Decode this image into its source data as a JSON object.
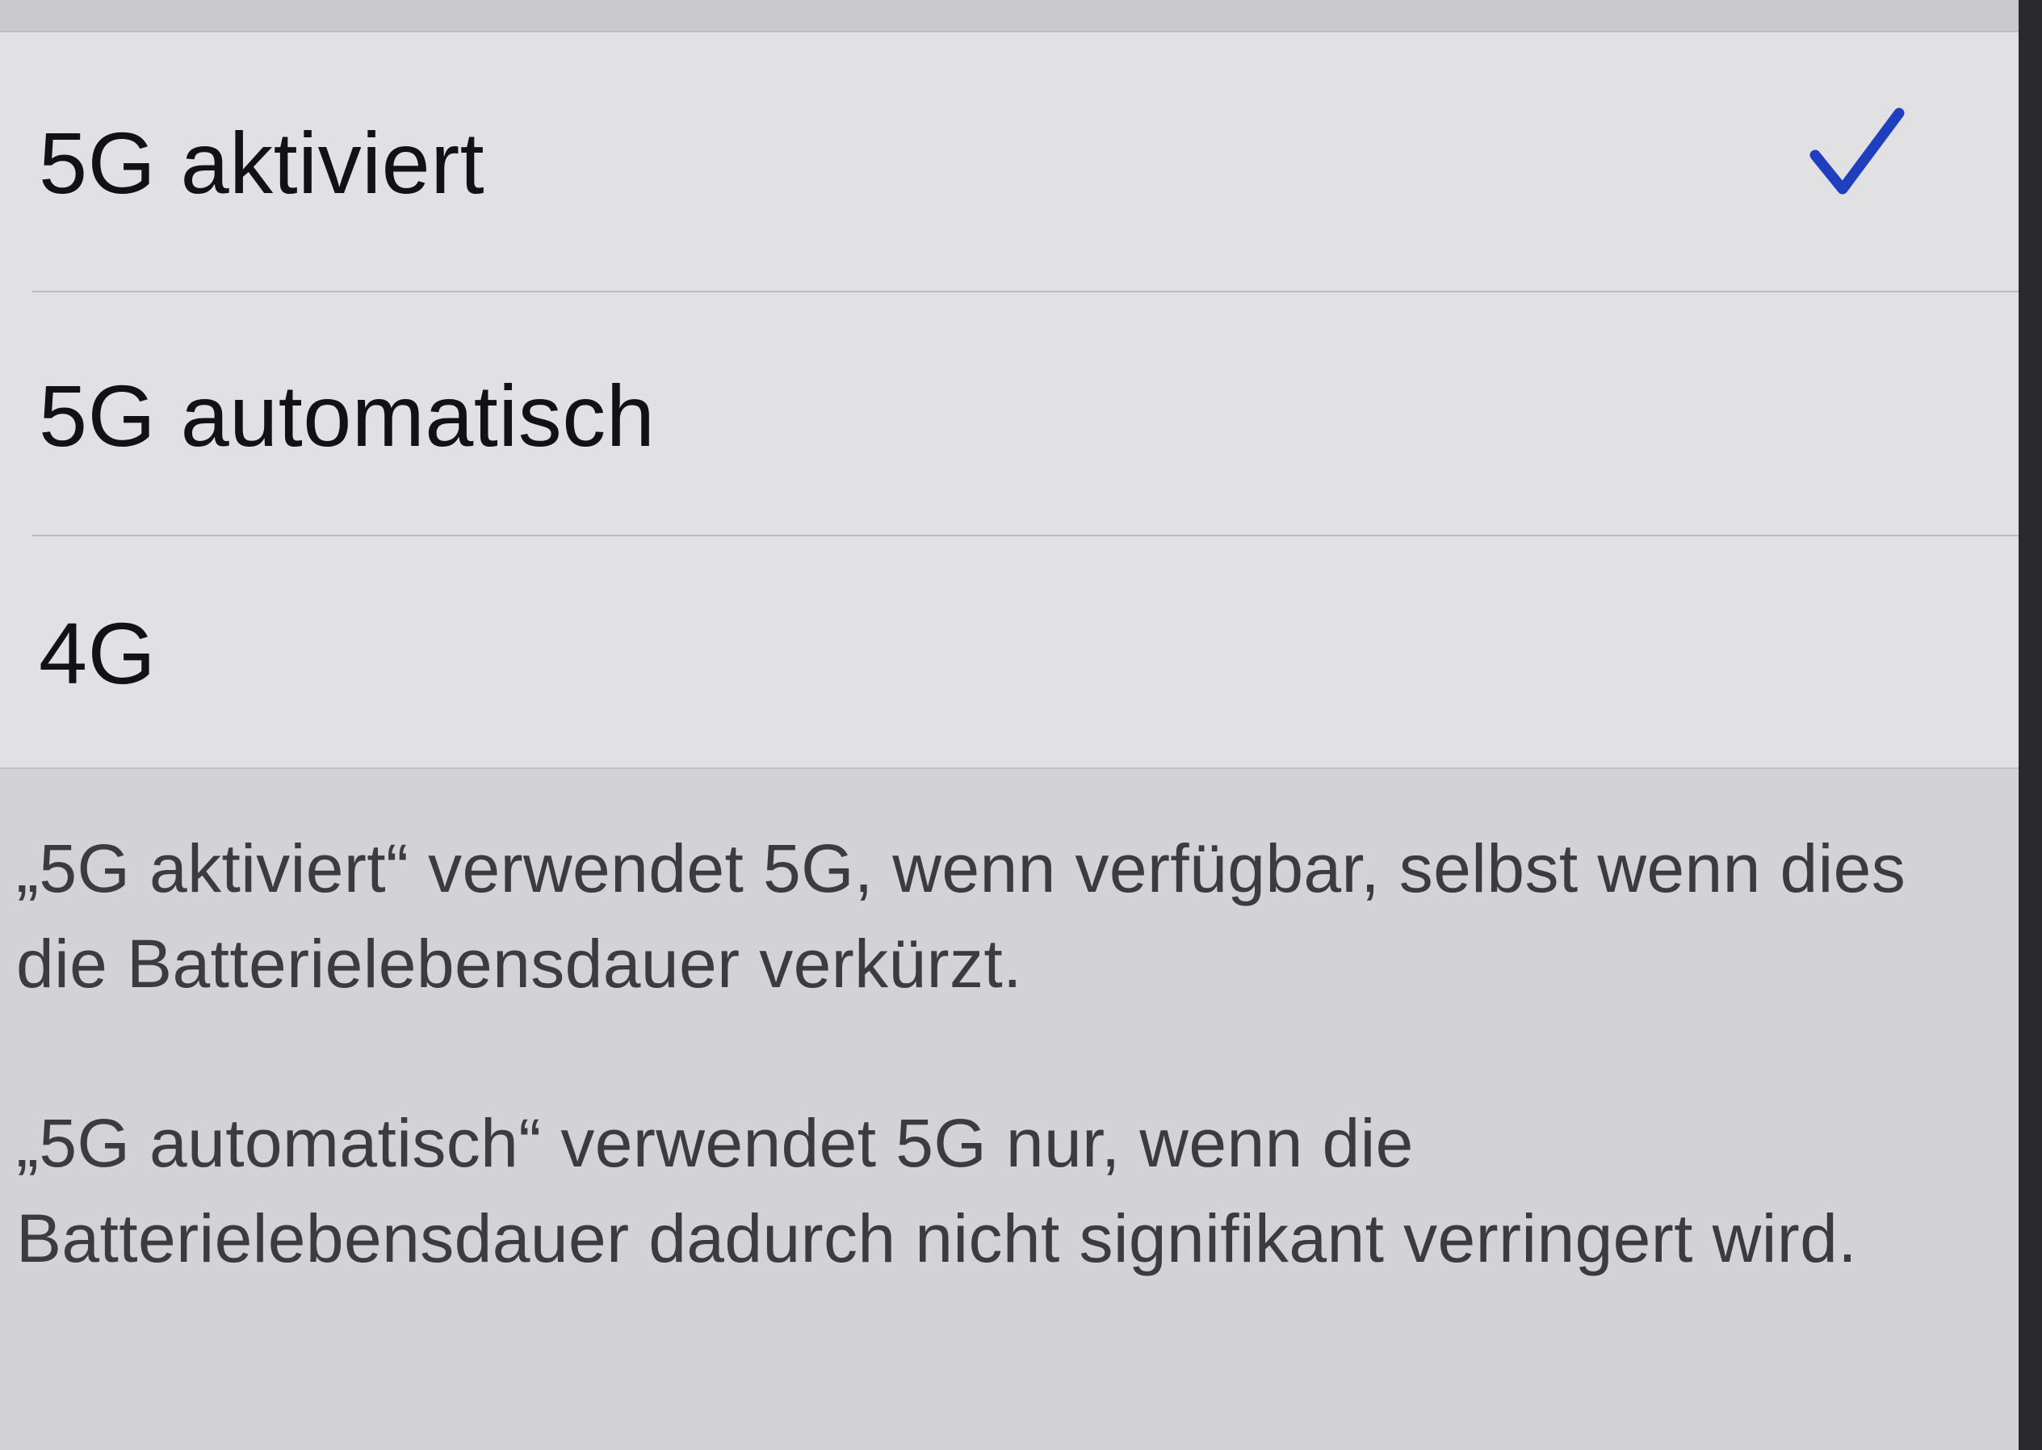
{
  "options": [
    {
      "label": "5G aktiviert",
      "selected": true
    },
    {
      "label": "5G automatisch",
      "selected": false
    },
    {
      "label": "4G",
      "selected": false
    }
  ],
  "footer": {
    "description_1": "„5G aktiviert“ verwendet 5G, wenn verfügbar, selbst wenn dies die Batterielebensdauer verkürzt.",
    "description_2": "„5G automatisch“ verwendet 5G nur, wenn die Batterielebensdauer dadurch nicht signifikant verringert wird."
  },
  "icons": {
    "selected_option": "checkmark-icon"
  },
  "colors": {
    "accent": "#1f3fbf",
    "group_background": "#e1e0e3",
    "page_background": "#d3d2d6",
    "label_text": "#121214",
    "footer_text": "#3b3b40"
  }
}
